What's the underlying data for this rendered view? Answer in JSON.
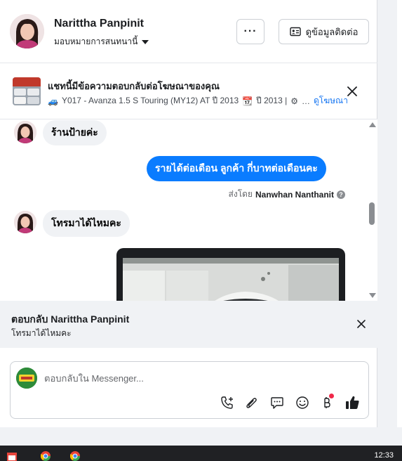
{
  "header": {
    "name": "Narittha Panpinit",
    "assign_label": "มอบหมายการสนทนานี้",
    "more_label": "···",
    "contact_label": "ดูข้อมูลติดต่อ"
  },
  "ad": {
    "title": "แชทนี้มีข้อความตอบกลับต่อโฆษณาของคุณ",
    "subtitle": "Y017 - Avanza 1.5 S Touring (MY12) AT ปี 2013",
    "year_label": "ปี 2013 |",
    "ellipsis": "…",
    "link_label": "ดูโฆษณา"
  },
  "messages": [
    {
      "direction": "in",
      "text": "ร้านป้ายค่ะ"
    },
    {
      "direction": "out",
      "text": "รายได้ต่อเดือน  ลูกค้า  กี่บาทต่อเดือนคะ"
    },
    {
      "direction": "in",
      "text": "โทรมาได้ไหมคะ"
    }
  ],
  "sent_by": {
    "prefix": "ส่งโดย",
    "name": "Nanwhan Nanthanit",
    "help": "?"
  },
  "reply": {
    "title": "ตอบกลับ Narittha Panpinit",
    "quote": "โทรมาได้ไหมคะ"
  },
  "composer": {
    "placeholder": "ตอบกลับใน Messenger...",
    "value": ""
  },
  "taskbar": {
    "time": "12:33"
  },
  "colors": {
    "accent": "#0a7cff",
    "link": "#1877f2",
    "badge": "#f02849"
  }
}
